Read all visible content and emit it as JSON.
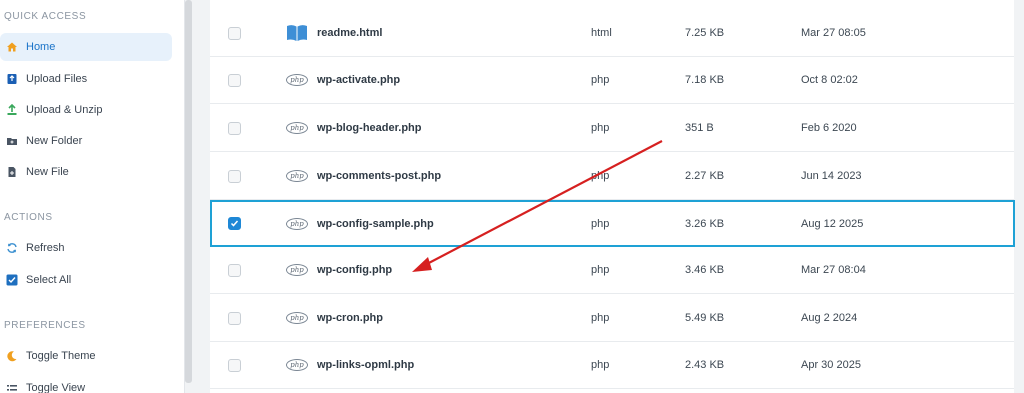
{
  "sidebar": {
    "quick_access_title": "QUICK ACCESS",
    "quick_access": [
      {
        "label": "Home",
        "icon": "home-icon",
        "active": true
      },
      {
        "label": "Upload Files",
        "icon": "upload-icon"
      },
      {
        "label": "Upload & Unzip",
        "icon": "upload-unzip-icon"
      },
      {
        "label": "New Folder",
        "icon": "new-folder-icon"
      },
      {
        "label": "New File",
        "icon": "new-file-icon"
      }
    ],
    "actions_title": "ACTIONS",
    "actions": [
      {
        "label": "Refresh",
        "icon": "refresh-icon"
      },
      {
        "label": "Select All",
        "icon": "select-all-icon"
      }
    ],
    "preferences_title": "PREFERENCES",
    "preferences": [
      {
        "label": "Toggle Theme",
        "icon": "moon-icon"
      },
      {
        "label": "Toggle View",
        "icon": "list-view-icon"
      }
    ]
  },
  "files": [
    {
      "name": "readme.html",
      "type": "html",
      "size": "7.25 KB",
      "modified": "Mar 27 08:05",
      "icon": "book-icon",
      "selected": false
    },
    {
      "name": "wp-activate.php",
      "type": "php",
      "size": "7.18 KB",
      "modified": "Oct 8 02:02",
      "icon": "php-icon",
      "selected": false
    },
    {
      "name": "wp-blog-header.php",
      "type": "php",
      "size": "351 B",
      "modified": "Feb 6 2020",
      "icon": "php-icon",
      "selected": false
    },
    {
      "name": "wp-comments-post.php",
      "type": "php",
      "size": "2.27 KB",
      "modified": "Jun 14 2023",
      "icon": "php-icon",
      "selected": false
    },
    {
      "name": "wp-config-sample.php",
      "type": "php",
      "size": "3.26 KB",
      "modified": "Aug 12 2025",
      "icon": "php-icon",
      "selected": true
    },
    {
      "name": "wp-config.php",
      "type": "php",
      "size": "3.46 KB",
      "modified": "Mar 27 08:04",
      "icon": "php-icon",
      "selected": false
    },
    {
      "name": "wp-cron.php",
      "type": "php",
      "size": "5.49 KB",
      "modified": "Aug 2 2024",
      "icon": "php-icon",
      "selected": false
    },
    {
      "name": "wp-links-opml.php",
      "type": "php",
      "size": "2.43 KB",
      "modified": "Apr 30 2025",
      "icon": "php-icon",
      "selected": false
    }
  ],
  "php_badge_text": "php",
  "colors": {
    "accent": "#1e88d6",
    "selected_border": "#1ea1d5",
    "annotation_arrow": "#d62020",
    "home_icon": "#f0a020",
    "upload_icon": "#1a5fb4",
    "upload_unzip_icon": "#3aa85c"
  }
}
